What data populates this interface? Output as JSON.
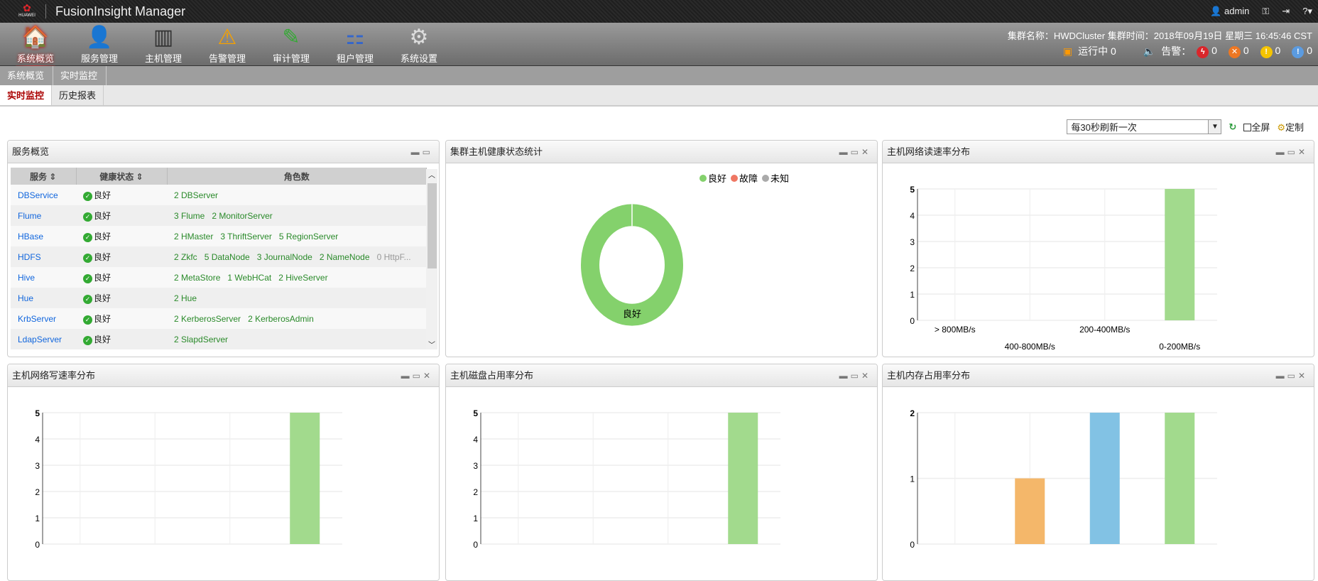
{
  "app": {
    "logo_text": "HUAWEI",
    "title": "FusionInsight Manager",
    "user": "admin",
    "help": "?"
  },
  "nav": [
    {
      "label": "系统概览",
      "icon": "home-icon"
    },
    {
      "label": "服务管理",
      "icon": "service-icon"
    },
    {
      "label": "主机管理",
      "icon": "server-icon"
    },
    {
      "label": "告警管理",
      "icon": "warning-icon"
    },
    {
      "label": "审计管理",
      "icon": "audit-icon"
    },
    {
      "label": "租户管理",
      "icon": "tenant-icon"
    },
    {
      "label": "系统设置",
      "icon": "gear-icon"
    }
  ],
  "cluster": {
    "info": "集群名称：HWDCluster   集群时间：2018年09月19日 星期三 16:45:46 CST",
    "running": "运行中 0",
    "alarm_label": "告警：",
    "alarms": [
      {
        "count": "0",
        "color": "#d9262b",
        "glyph": "ϟ"
      },
      {
        "count": "0",
        "color": "#ee7722",
        "glyph": "✕"
      },
      {
        "count": "0",
        "color": "#f5c400",
        "glyph": "!"
      },
      {
        "count": "0",
        "color": "#5b9be0",
        "glyph": "!"
      }
    ]
  },
  "breadcrumb": [
    "系统概览",
    "实时监控"
  ],
  "tabs": [
    "实时监控",
    "历史报表"
  ],
  "toolbar": {
    "refresh": "每30秒刷新一次",
    "fullscreen": "全屏",
    "customize": "定制"
  },
  "service_panel": {
    "title": "服务概览",
    "headers": [
      "服务",
      "健康状态",
      "角色数"
    ],
    "rows": [
      {
        "service": "DBService",
        "status": "良好",
        "roles": [
          "2 DBServer"
        ]
      },
      {
        "service": "Flume",
        "status": "良好",
        "roles": [
          "3 Flume",
          "2 MonitorServer"
        ]
      },
      {
        "service": "HBase",
        "status": "良好",
        "roles": [
          "2 HMaster",
          "3 ThriftServer",
          "5 RegionServer"
        ]
      },
      {
        "service": "HDFS",
        "status": "良好",
        "roles": [
          "2 Zkfc",
          "5 DataNode",
          "3 JournalNode",
          "2 NameNode"
        ],
        "extra": "0 HttpF..."
      },
      {
        "service": "Hive",
        "status": "良好",
        "roles": [
          "2 MetaStore",
          "1 WebHCat",
          "2 HiveServer"
        ]
      },
      {
        "service": "Hue",
        "status": "良好",
        "roles": [
          "2 Hue"
        ]
      },
      {
        "service": "KrbServer",
        "status": "良好",
        "roles": [
          "2 KerberosServer",
          "2 KerberosAdmin"
        ]
      },
      {
        "service": "LdapServer",
        "status": "良好",
        "roles": [
          "2 SlapdServer"
        ]
      }
    ]
  },
  "chart_data": [
    {
      "id": "health",
      "title": "集群主机健康状态统计",
      "type": "pie",
      "donut": true,
      "legend": [
        {
          "name": "良好",
          "color": "#84d16c"
        },
        {
          "name": "故障",
          "color": "#ef7763"
        },
        {
          "name": "未知",
          "color": "#aaaaaa"
        }
      ],
      "values": [
        5,
        0,
        0
      ],
      "slice_label": "良好",
      "legend_position": "top-right"
    },
    {
      "id": "netread",
      "title": "主机网络读速率分布",
      "type": "bar",
      "categories": [
        "> 800MB/s",
        "400-800MB/s",
        "200-400MB/s",
        "0-200MB/s"
      ],
      "values": [
        0,
        0,
        0,
        5
      ],
      "colors": [
        "#a2da8d",
        "#a2da8d",
        "#a2da8d",
        "#a2da8d"
      ],
      "ylim": [
        0,
        5
      ],
      "yticks": [
        "0",
        "1",
        "2",
        "3",
        "4",
        "5"
      ],
      "grid": true
    },
    {
      "id": "netwrite",
      "title": "主机网络写速率分布",
      "type": "bar",
      "categories": [],
      "values": [
        0,
        0,
        0,
        5
      ],
      "colors": [
        "#a2da8d",
        "#a2da8d",
        "#a2da8d",
        "#a2da8d"
      ],
      "ylim": [
        0,
        5
      ],
      "yticks": [
        "0",
        "1",
        "2",
        "3",
        "4",
        "5"
      ],
      "grid": true
    },
    {
      "id": "disk",
      "title": "主机磁盘占用率分布",
      "type": "bar",
      "categories": [],
      "values": [
        0,
        0,
        0,
        5
      ],
      "colors": [
        "#a2da8d",
        "#a2da8d",
        "#a2da8d",
        "#a2da8d"
      ],
      "ylim": [
        0,
        5
      ],
      "yticks": [
        "0",
        "1",
        "2",
        "3",
        "4",
        "5"
      ],
      "grid": true
    },
    {
      "id": "mem",
      "title": "主机内存占用率分布",
      "type": "bar",
      "categories": [],
      "values": [
        0,
        1,
        2,
        2
      ],
      "colors": [
        "#a2da8d",
        "#f4b76a",
        "#82c2e4",
        "#a2da8d"
      ],
      "ylim": [
        0,
        2
      ],
      "yticks": [
        "0",
        "1",
        "2"
      ],
      "grid": true
    }
  ]
}
